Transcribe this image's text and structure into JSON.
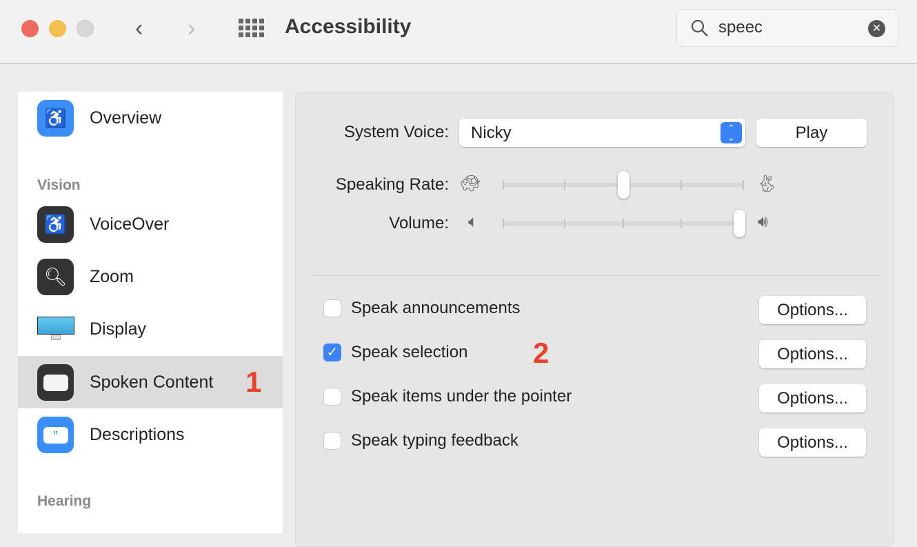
{
  "window": {
    "title": "Accessibility",
    "traffic_colors": [
      "#ee6a5e",
      "#f5bf4f",
      "#d6d6d6"
    ]
  },
  "search": {
    "value": "speec"
  },
  "sidebar": {
    "items": [
      {
        "label": "Overview",
        "icon": "accessibility-icon",
        "color": "#3a8ef6"
      },
      {
        "label": "VoiceOver",
        "icon": "voiceover-icon",
        "color": "#333333"
      },
      {
        "label": "Zoom",
        "icon": "zoom-icon",
        "color": "#333333"
      },
      {
        "label": "Display",
        "icon": "display-icon",
        "color": "#4fb8e6"
      },
      {
        "label": "Spoken Content",
        "icon": "spoken-content-icon",
        "color": "#333333",
        "selected": true
      },
      {
        "label": "Descriptions",
        "icon": "descriptions-icon",
        "color": "#3a8ef6"
      }
    ],
    "sections": {
      "vision": "Vision",
      "hearing": "Hearing"
    },
    "annotation": "1"
  },
  "main": {
    "system_voice_label": "System Voice:",
    "system_voice_value": "Nicky",
    "play_label": "Play",
    "speaking_rate_label": "Speaking Rate:",
    "speaking_rate_value": 0.5,
    "volume_label": "Volume:",
    "volume_value": 0.98,
    "options": [
      {
        "label": "Speak announcements",
        "checked": false,
        "button": "Options..."
      },
      {
        "label": "Speak selection",
        "checked": true,
        "button": "Options..."
      },
      {
        "label": "Speak items under the pointer",
        "checked": false,
        "button": "Options..."
      },
      {
        "label": "Speak typing feedback",
        "checked": false,
        "button": "Options..."
      }
    ],
    "annotation": "2",
    "accent": "#3b82f6"
  }
}
